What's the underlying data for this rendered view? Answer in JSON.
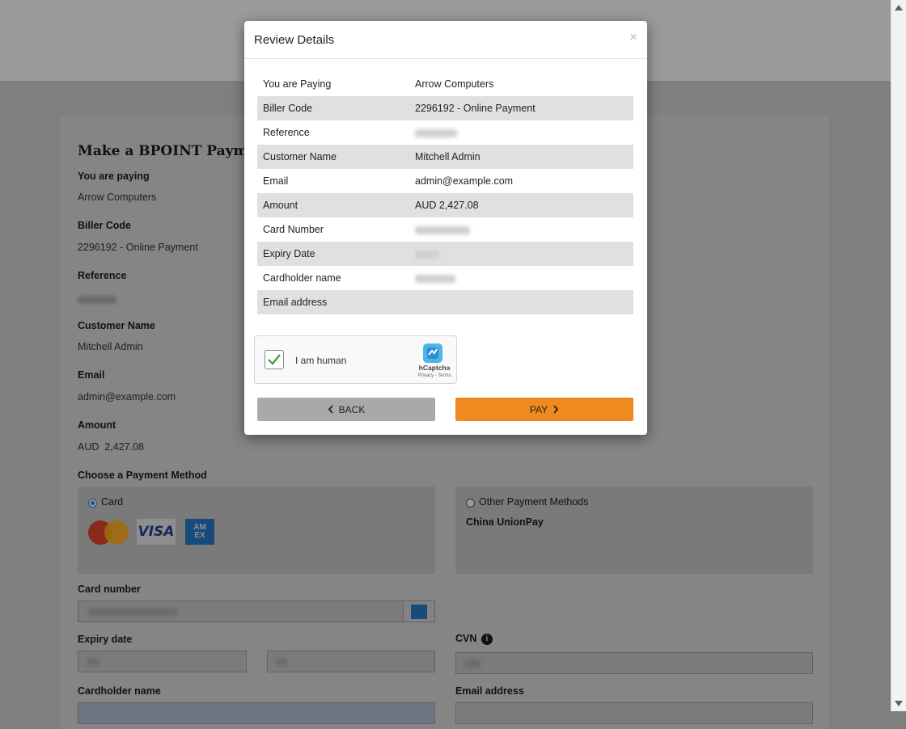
{
  "form": {
    "title": "Make a BPOINT Payment",
    "you_are_paying_label": "You are paying",
    "you_are_paying_value": "Arrow Computers",
    "biller_code_label": "Biller Code",
    "biller_code_value": "2296192 - Online Payment",
    "reference_label": "Reference",
    "customer_name_label": "Customer Name",
    "customer_name_value": "Mitchell Admin",
    "email_label": "Email",
    "email_value": "admin@example.com",
    "amount_label": "Amount",
    "amount_value": "AUD  2,427.08",
    "payment_method_label": "Choose a Payment Method",
    "card_option_label": "Card",
    "other_methods_label": "Other Payment Methods",
    "china_unionpay_label": "China UnionPay",
    "card_number_label": "Card number",
    "expiry_date_label": "Expiry date",
    "cvn_label": "CVN",
    "cardholder_name_label": "Cardholder name",
    "email_address_label": "Email address",
    "visa_text": "VISA",
    "amex_text": "AM EX"
  },
  "modal": {
    "title": "Review Details",
    "close_glyph": "×",
    "rows": [
      {
        "label": "You are Paying",
        "value": "Arrow Computers"
      },
      {
        "label": "Biller Code",
        "value": "2296192 - Online Payment"
      },
      {
        "label": "Reference",
        "value": ""
      },
      {
        "label": "Customer Name",
        "value": "Mitchell Admin"
      },
      {
        "label": "Email",
        "value": "admin@example.com"
      },
      {
        "label": "Amount",
        "value": "AUD 2,427.08"
      },
      {
        "label": "Card Number",
        "value": ""
      },
      {
        "label": "Expiry Date",
        "value": ""
      },
      {
        "label": "Cardholder name",
        "value": ""
      },
      {
        "label": "Email address",
        "value": ""
      }
    ],
    "captcha": {
      "label": "I am human",
      "brand": "hCaptcha",
      "links": "Privacy - Terms",
      "checked": true
    },
    "back_label": "BACK",
    "pay_label": "PAY"
  },
  "colors": {
    "pay_button": "#f0891f",
    "back_button": "#a9a9a9",
    "radio_selected": "#1a4f9c"
  }
}
